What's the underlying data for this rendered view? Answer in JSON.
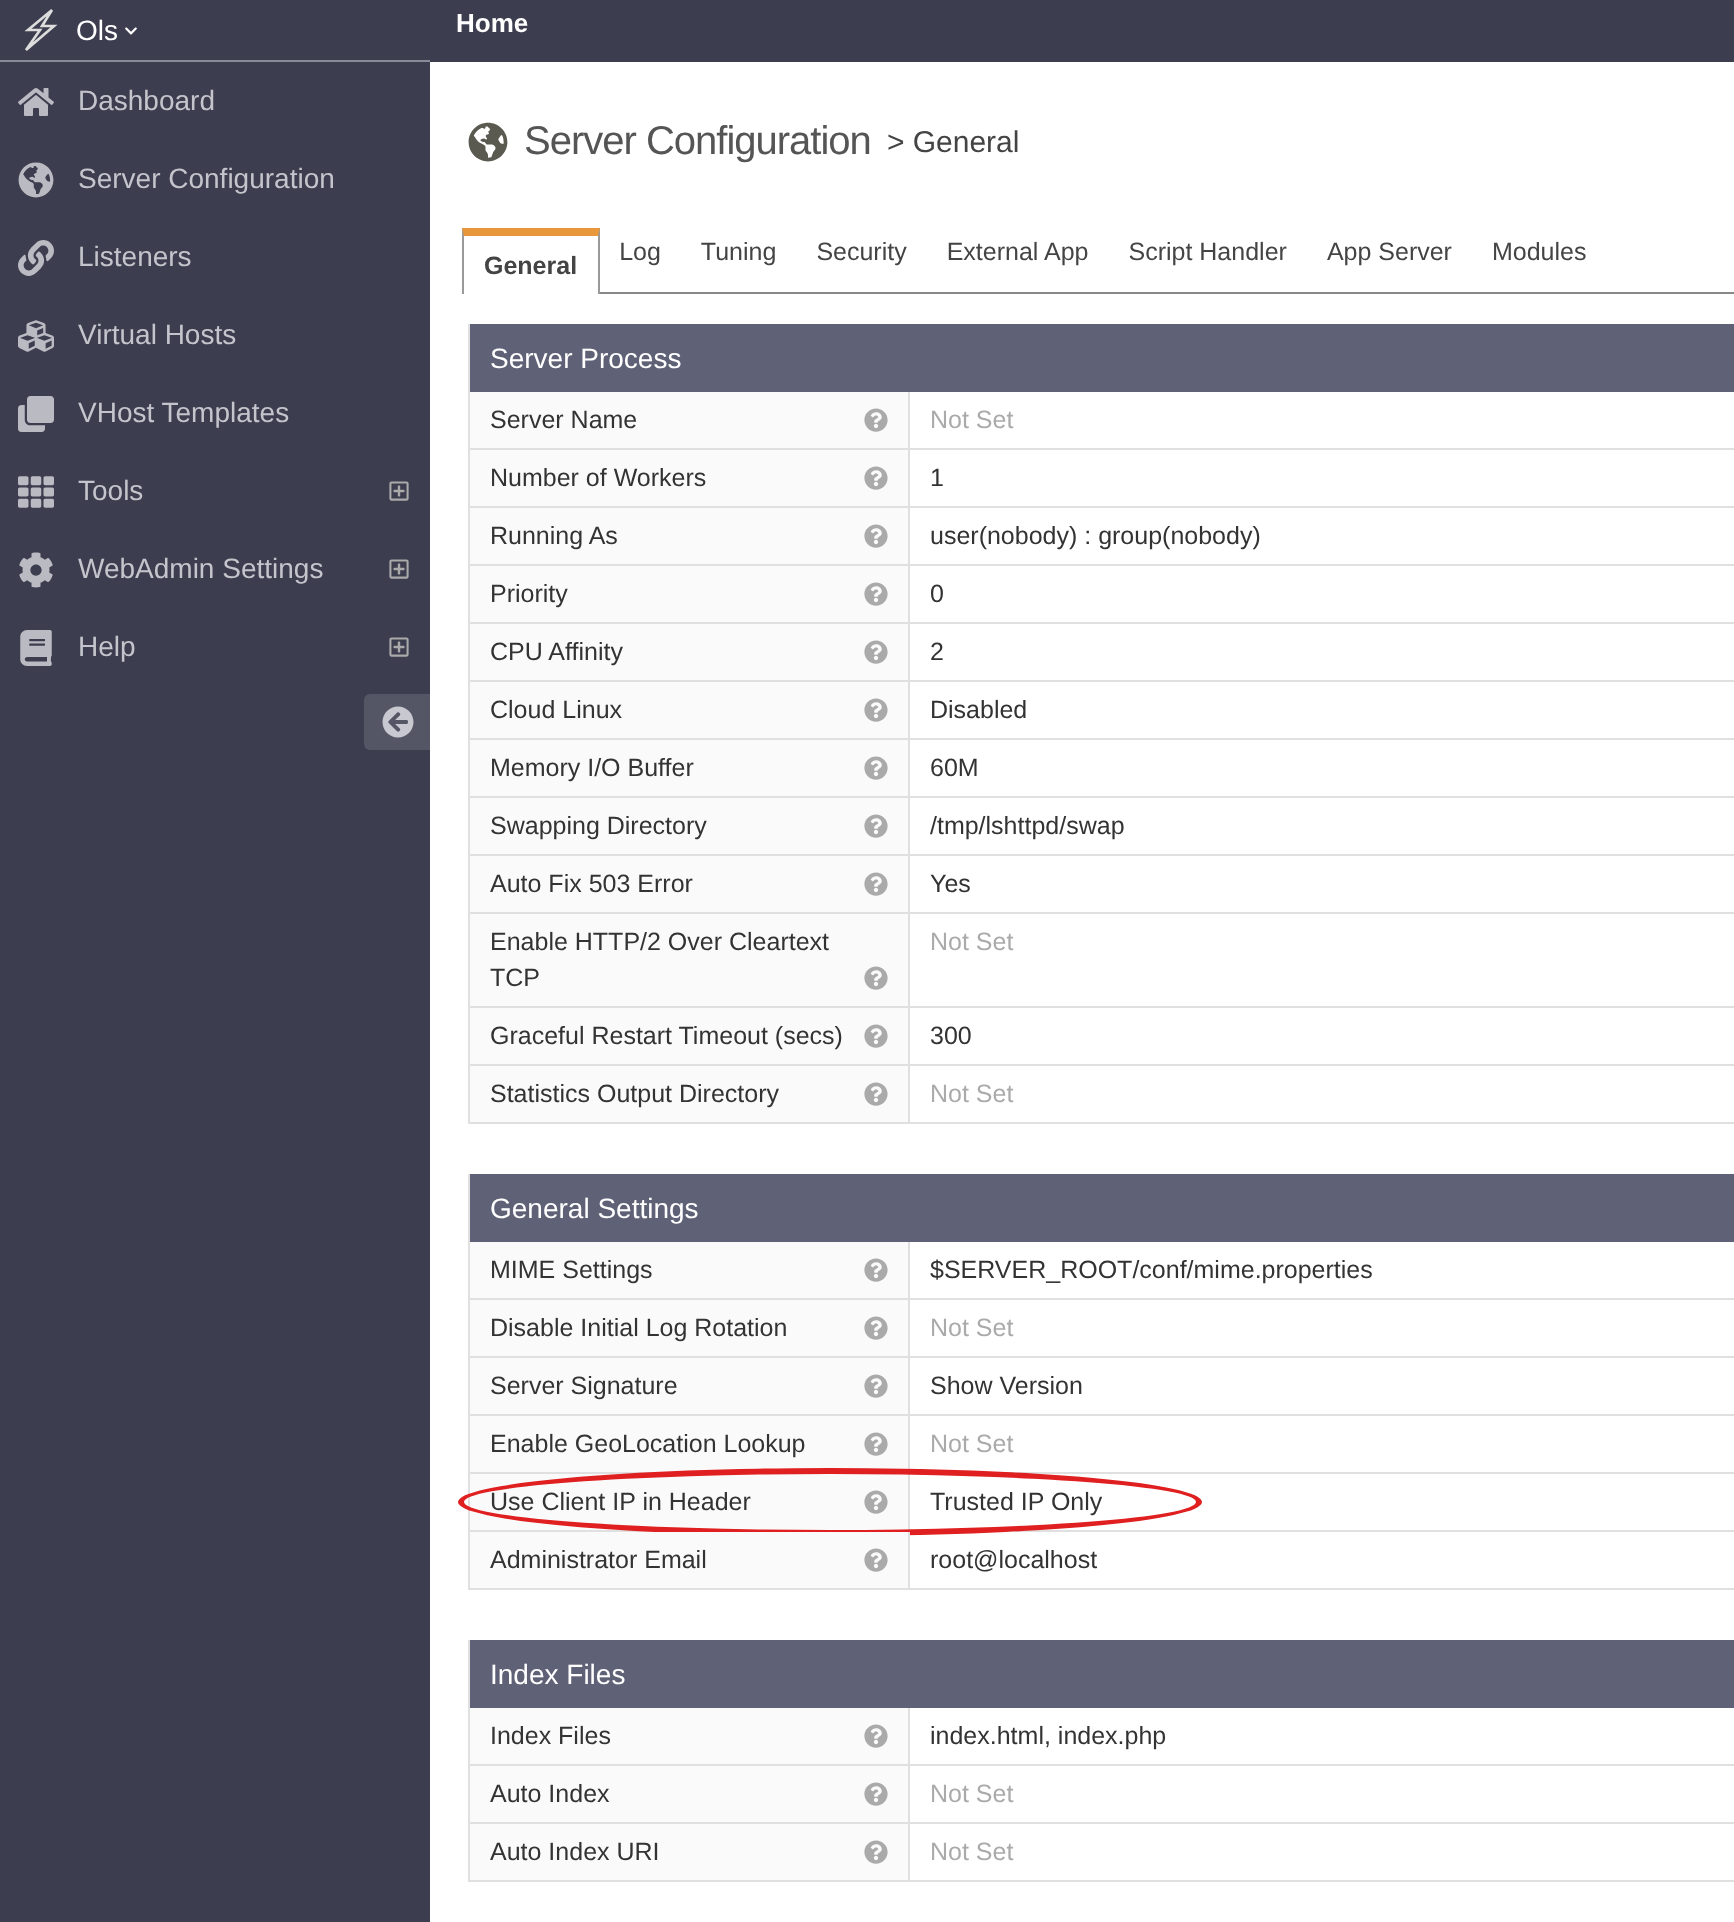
{
  "brand": {
    "name": "Ols"
  },
  "topbar": {
    "breadcrumb": "Home"
  },
  "sidebar": {
    "items": [
      {
        "label": "Dashboard",
        "expandable": false
      },
      {
        "label": "Server Configuration",
        "expandable": false
      },
      {
        "label": "Listeners",
        "expandable": false
      },
      {
        "label": "Virtual Hosts",
        "expandable": false
      },
      {
        "label": "VHost Templates",
        "expandable": false
      },
      {
        "label": "Tools",
        "expandable": true
      },
      {
        "label": "WebAdmin Settings",
        "expandable": true
      },
      {
        "label": "Help",
        "expandable": true
      }
    ]
  },
  "page": {
    "title": "Server Configuration",
    "subtitle": "> General"
  },
  "tabs": [
    {
      "label": "General",
      "selected": true
    },
    {
      "label": "Log",
      "selected": false
    },
    {
      "label": "Tuning",
      "selected": false
    },
    {
      "label": "Security",
      "selected": false
    },
    {
      "label": "External App",
      "selected": false
    },
    {
      "label": "Script Handler",
      "selected": false
    },
    {
      "label": "App Server",
      "selected": false
    },
    {
      "label": "Modules",
      "selected": false
    }
  ],
  "sections": [
    {
      "title": "Server Process",
      "rows": [
        {
          "label": "Server Name",
          "value": "Not Set",
          "unset": true,
          "highlighted": false
        },
        {
          "label": "Number of Workers",
          "value": "1",
          "unset": false,
          "highlighted": false
        },
        {
          "label": "Running As",
          "value": "user(nobody) : group(nobody)",
          "unset": false,
          "highlighted": false
        },
        {
          "label": "Priority",
          "value": "0",
          "unset": false,
          "highlighted": false
        },
        {
          "label": "CPU Affinity",
          "value": "2",
          "unset": false,
          "highlighted": false
        },
        {
          "label": "Cloud Linux",
          "value": "Disabled",
          "unset": false,
          "highlighted": false
        },
        {
          "label": "Memory I/O Buffer",
          "value": "60M",
          "unset": false,
          "highlighted": false
        },
        {
          "label": "Swapping Directory",
          "value": "/tmp/lshttpd/swap",
          "unset": false,
          "highlighted": false
        },
        {
          "label": "Auto Fix 503 Error",
          "value": "Yes",
          "unset": false,
          "highlighted": false
        },
        {
          "label": "Enable HTTP/2 Over Cleartext TCP",
          "value": "Not Set",
          "unset": true,
          "highlighted": false
        },
        {
          "label": "Graceful Restart Timeout (secs)",
          "value": "300",
          "unset": false,
          "highlighted": false
        },
        {
          "label": "Statistics Output Directory",
          "value": "Not Set",
          "unset": true,
          "highlighted": false
        }
      ]
    },
    {
      "title": "General Settings",
      "rows": [
        {
          "label": "MIME Settings",
          "value": "$SERVER_ROOT/conf/mime.properties",
          "unset": false,
          "highlighted": false
        },
        {
          "label": "Disable Initial Log Rotation",
          "value": "Not Set",
          "unset": true,
          "highlighted": false
        },
        {
          "label": "Server Signature",
          "value": "Show Version",
          "unset": false,
          "highlighted": false
        },
        {
          "label": "Enable GeoLocation Lookup",
          "value": "Not Set",
          "unset": true,
          "highlighted": false
        },
        {
          "label": "Use Client IP in Header",
          "value": "Trusted IP Only",
          "unset": false,
          "highlighted": true
        },
        {
          "label": "Administrator Email",
          "value": "root@localhost",
          "unset": false,
          "highlighted": false
        }
      ]
    },
    {
      "title": "Index Files",
      "rows": [
        {
          "label": "Index Files",
          "value": "index.html, index.php",
          "unset": false,
          "highlighted": false
        },
        {
          "label": "Auto Index",
          "value": "Not Set",
          "unset": true,
          "highlighted": false
        },
        {
          "label": "Auto Index URI",
          "value": "Not Set",
          "unset": true,
          "highlighted": false
        }
      ]
    }
  ]
}
